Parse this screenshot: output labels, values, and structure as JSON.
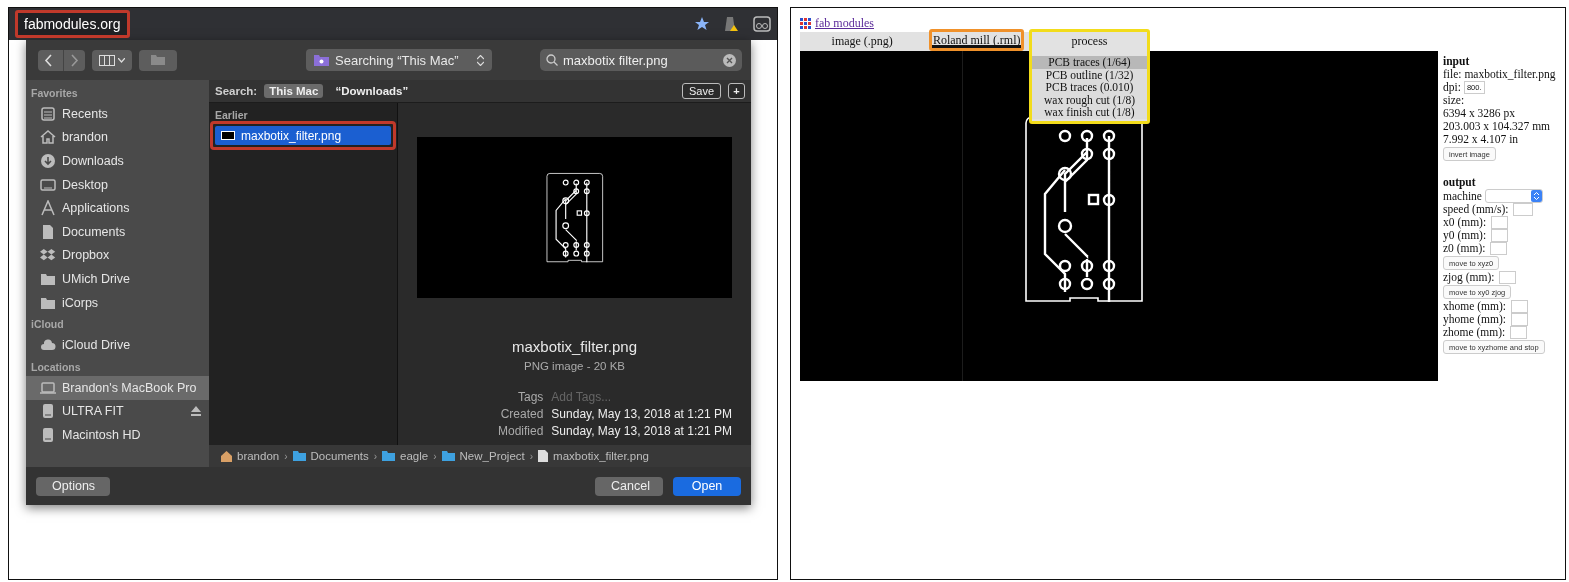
{
  "left": {
    "browser": {
      "address": "fabmodules.org",
      "color": "#c0392b"
    },
    "dialog": {
      "location": "Searching “This Mac”",
      "search": "maxbotix filter.png",
      "sidebar": [
        {
          "heading": "Favorites",
          "items": [
            {
              "label": "Recents",
              "kind": "recents",
              "selected": false,
              "ejectable": false
            },
            {
              "label": "brandon",
              "kind": "home",
              "selected": false,
              "ejectable": false
            },
            {
              "label": "Downloads",
              "kind": "downloads",
              "selected": false,
              "ejectable": false
            },
            {
              "label": "Desktop",
              "kind": "desktop",
              "selected": false,
              "ejectable": false
            },
            {
              "label": "Applications",
              "kind": "applications",
              "selected": false,
              "ejectable": false
            },
            {
              "label": "Documents",
              "kind": "documents",
              "selected": false,
              "ejectable": false
            },
            {
              "label": "Dropbox",
              "kind": "dropbox",
              "selected": false,
              "ejectable": false
            },
            {
              "label": "UMich Drive",
              "kind": "folder",
              "selected": false,
              "ejectable": false
            },
            {
              "label": "iCorps",
              "kind": "folder",
              "selected": false,
              "ejectable": false
            }
          ]
        },
        {
          "heading": "iCloud",
          "items": [
            {
              "label": "iCloud Drive",
              "kind": "cloud",
              "selected": false,
              "ejectable": false
            }
          ]
        },
        {
          "heading": "Locations",
          "items": [
            {
              "label": "Brandon's MacBook Pro",
              "kind": "laptop",
              "selected": true,
              "ejectable": false
            },
            {
              "label": "ULTRA FIT",
              "kind": "drive",
              "selected": false,
              "ejectable": true
            },
            {
              "label": "Macintosh HD",
              "kind": "drive",
              "selected": false,
              "ejectable": false
            }
          ]
        }
      ],
      "scope": {
        "label": "Search:",
        "options": [
          {
            "label": "This Mac",
            "selected": true
          },
          {
            "label": "“Downloads”",
            "selected": false
          }
        ],
        "save": "Save",
        "add": "+"
      },
      "group": "Earlier",
      "files": [
        {
          "name": "maxbotix_filter.png",
          "selected": true,
          "color": "#c0392b"
        }
      ],
      "preview": {
        "name": "maxbotix_filter.png",
        "type": "PNG image - 20 KB",
        "meta": [
          {
            "key": "Tags",
            "placeholder": "Add Tags..."
          },
          {
            "key": "Created",
            "value": "Sunday, May 13, 2018 at 1:21 PM"
          },
          {
            "key": "Modified",
            "value": "Sunday, May 13, 2018 at 1:21 PM"
          }
        ]
      },
      "path": [
        {
          "label": "brandon",
          "kind": "home",
          "separator": "›"
        },
        {
          "label": "Documents",
          "kind": "folder",
          "separator": "›"
        },
        {
          "label": "eagle",
          "kind": "folder",
          "separator": "›"
        },
        {
          "label": "New_Project",
          "kind": "folder",
          "separator": "›"
        },
        {
          "label": "maxbotix_filter.png",
          "kind": "file"
        }
      ],
      "buttons": {
        "options": "Options",
        "cancel": "Cancel",
        "open": "Open"
      }
    }
  },
  "right": {
    "link": "fab modules",
    "tabs": [
      {
        "label": "image (.png)",
        "selected": false,
        "expanded": false
      },
      {
        "label": "Roland mill (.rml)",
        "selected": true,
        "expanded": false,
        "color": "#f0912a"
      },
      {
        "label": "process",
        "selected": false,
        "expanded": true,
        "color": "#f2dc1b",
        "options": [
          {
            "label": "PCB traces (1/64)",
            "selected": true
          },
          {
            "label": "PCB outline (1/32)",
            "selected": false
          },
          {
            "label": "PCB traces (0.010)",
            "selected": false
          },
          {
            "label": "wax rough cut (1/8)",
            "selected": false
          },
          {
            "label": "wax finish cut (1/8)",
            "selected": false
          }
        ]
      }
    ],
    "input": {
      "heading": "input",
      "file": "file: maxbotix_filter.png",
      "dpi_label": "dpi:",
      "dpi": "800.",
      "size_label": "size:",
      "sizes": [
        "6394 x 3286 px",
        "203.003 x 104.327 mm",
        "7.992 x 4.107 in"
      ],
      "invert": "invert image"
    },
    "output": {
      "heading": "output",
      "rows": [
        {
          "kind": "select",
          "label": "machine"
        },
        {
          "kind": "field",
          "label": "speed (mm/s):"
        },
        {
          "kind": "field",
          "label": "x0 (mm):"
        },
        {
          "kind": "field",
          "label": "y0 (mm):"
        },
        {
          "kind": "field",
          "label": "z0 (mm):"
        },
        {
          "kind": "button",
          "label": "move to xyz0"
        },
        {
          "kind": "field",
          "label": "zjog (mm):"
        },
        {
          "kind": "button",
          "label": "move to xy0 zjog"
        },
        {
          "kind": "field",
          "label": "xhome (mm):"
        },
        {
          "kind": "field",
          "label": "yhome (mm):"
        },
        {
          "kind": "field",
          "label": "zhome (mm):"
        },
        {
          "kind": "button",
          "label": "move to xyzhome and stop"
        }
      ]
    }
  }
}
